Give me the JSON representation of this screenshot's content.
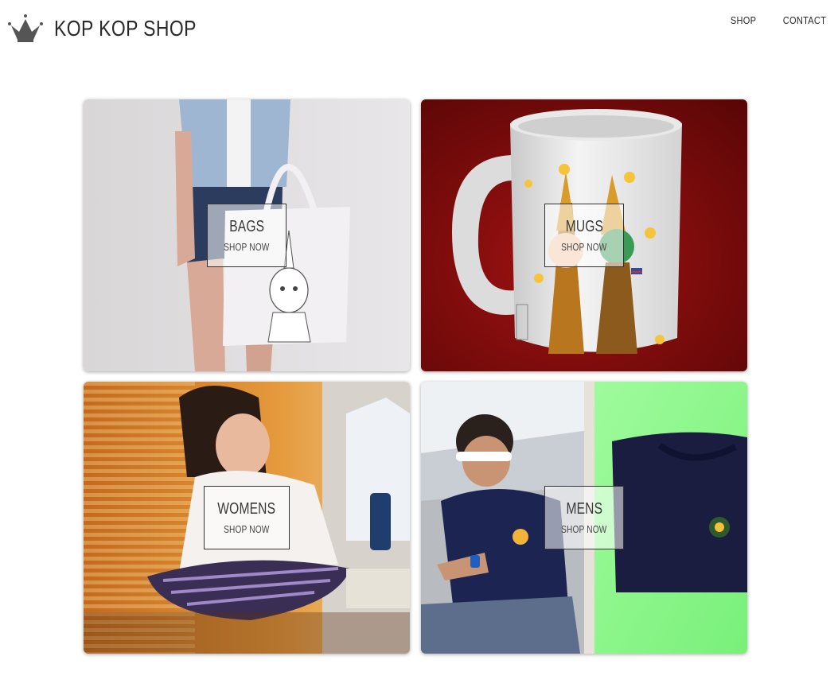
{
  "brand": {
    "name": "KOP KOP SHOP",
    "icon": "crown-icon"
  },
  "nav": {
    "items": [
      {
        "label": "SHOP"
      },
      {
        "label": "CONTACT"
      }
    ]
  },
  "categories": [
    {
      "title": "BAGS",
      "cta": "SHOP NOW"
    },
    {
      "title": "MUGS",
      "cta": "SHOP NOW"
    },
    {
      "title": "WOMENS",
      "cta": "SHOP NOW"
    },
    {
      "title": "MENS",
      "cta": "SHOP NOW"
    }
  ],
  "colors": {
    "text": "#2a2a2a",
    "crown": "#555555",
    "mugs_bg": "#6e0a0a",
    "mens_green": "#8cf58a"
  }
}
